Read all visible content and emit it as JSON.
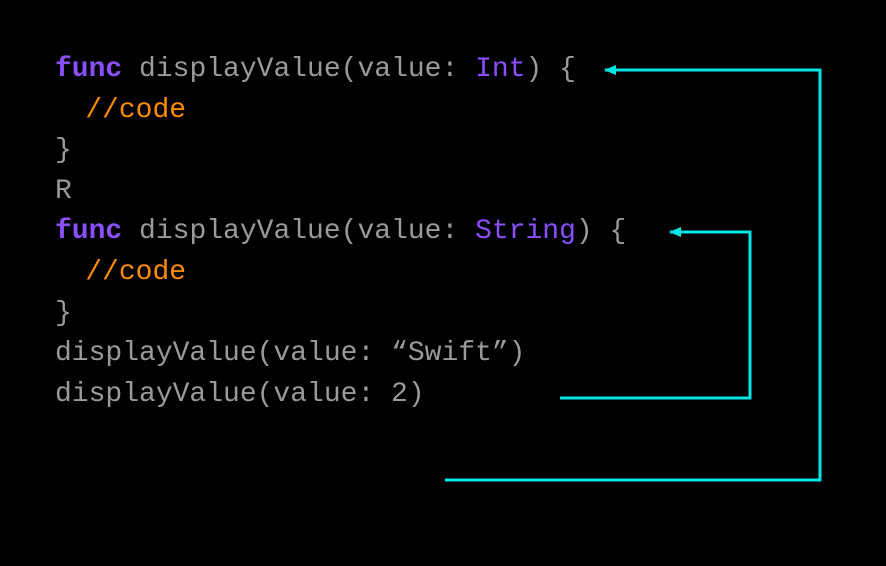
{
  "colors": {
    "keyword": "#8a4fff",
    "type": "#8a4fff",
    "comment": "#ff8c00",
    "default": "#9a9a9a",
    "arrow": "#00e5e5",
    "background": "#000000"
  },
  "code": {
    "line1": {
      "kw": "func",
      "sp": " ",
      "fn": "displayValue",
      "paren1": "(value: ",
      "ty": "Int",
      "paren2": ") {"
    },
    "line2": {
      "cm": "//code"
    },
    "line3": {
      "brace": "}"
    },
    "line4": {
      "r": "R"
    },
    "line5": {
      "kw": "func",
      "sp": " ",
      "fn": "displayValue",
      "paren1": "(value: ",
      "ty": "String",
      "paren2": ") {"
    },
    "line6": {
      "cm": "//code"
    },
    "line7": {
      "brace": "}"
    },
    "blank": "",
    "call1": "displayValue(value: “Swift”)",
    "blank2": "",
    "call2": "displayValue(value: 2)"
  },
  "arrows": [
    {
      "from": "call1",
      "to": "func-string",
      "description": "call with String routes to String overload"
    },
    {
      "from": "call2",
      "to": "func-int",
      "description": "call with Int routes to Int overload"
    }
  ]
}
